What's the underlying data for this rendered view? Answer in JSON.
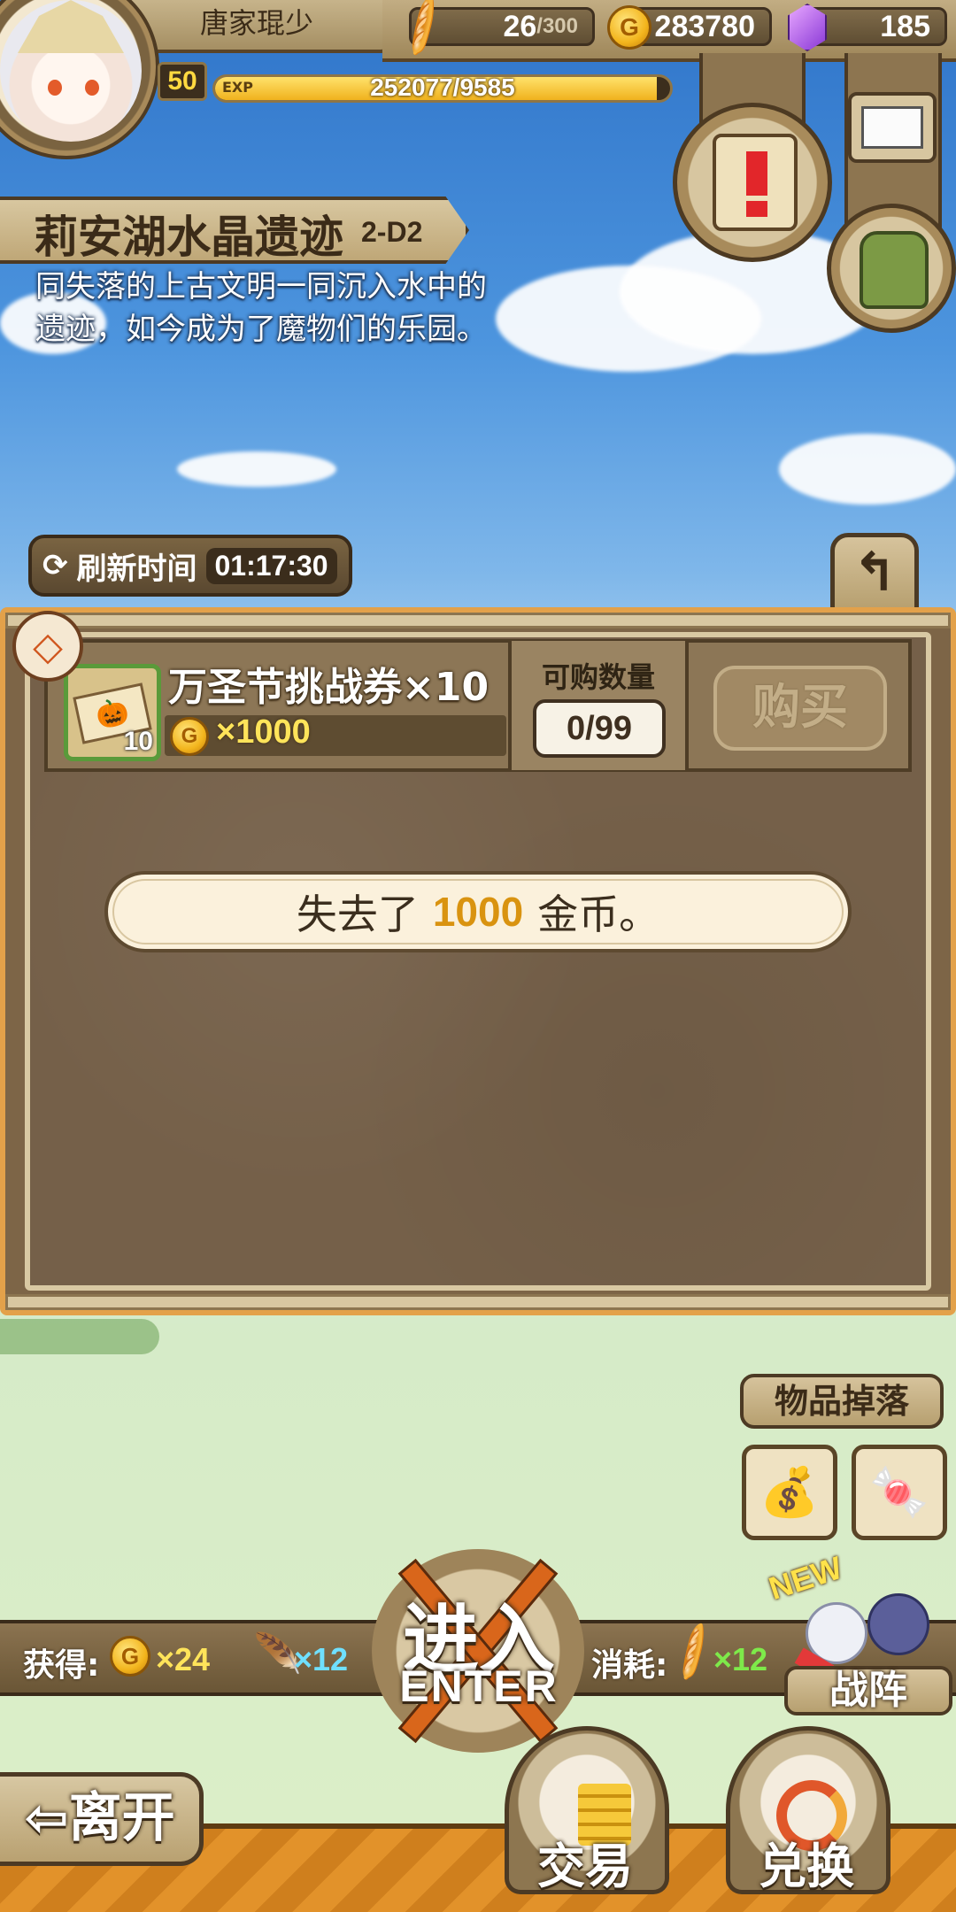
{
  "player": {
    "name": "唐家琨少",
    "level": "50",
    "exp_label": "EXP",
    "exp_text": "252077/9585",
    "exp_fraction": 0.97
  },
  "resources": {
    "stamina": "26",
    "stamina_max": "/300",
    "gold": "283780",
    "gems": "185"
  },
  "stage": {
    "name": "莉安湖水晶遗迹",
    "code": "2-D2",
    "description_line1": "同失落的上古文明一同沉入水中的",
    "description_line2": "遗迹，如今成为了魔物们的乐园。"
  },
  "shop": {
    "refresh_label": "刷新时间",
    "refresh_time": "01:17:30",
    "item_name": "万圣节挑战券×10",
    "item_count": "10",
    "price": "×1000",
    "qty_label": "可购数量",
    "qty_value": "0/99",
    "buy_label": "购买"
  },
  "toast": {
    "prefix": "失去了",
    "amount": "1000",
    "suffix": "金币。"
  },
  "drops": {
    "title": "物品掉落",
    "items": [
      "loot-bag-icon",
      "candy-icon"
    ]
  },
  "rewards": {
    "gain_label": "获得:",
    "gold_gain": "×24",
    "feather_gain": "×12",
    "cost_label": "消耗:",
    "stamina_cost": "×12"
  },
  "enter": {
    "main": "进入",
    "sub": "ENTER"
  },
  "formation": {
    "new_tag": "NEW",
    "label": "战阵"
  },
  "bottom": {
    "leave": "离开",
    "trade": "交易",
    "exchange": "兑换"
  },
  "coin_glyph": "G",
  "colors": {
    "gold_text": "#ffe45a",
    "feather_text": "#6fe0ff",
    "stamina_text": "#7eea4a",
    "toast_highlight": "#d99310"
  }
}
